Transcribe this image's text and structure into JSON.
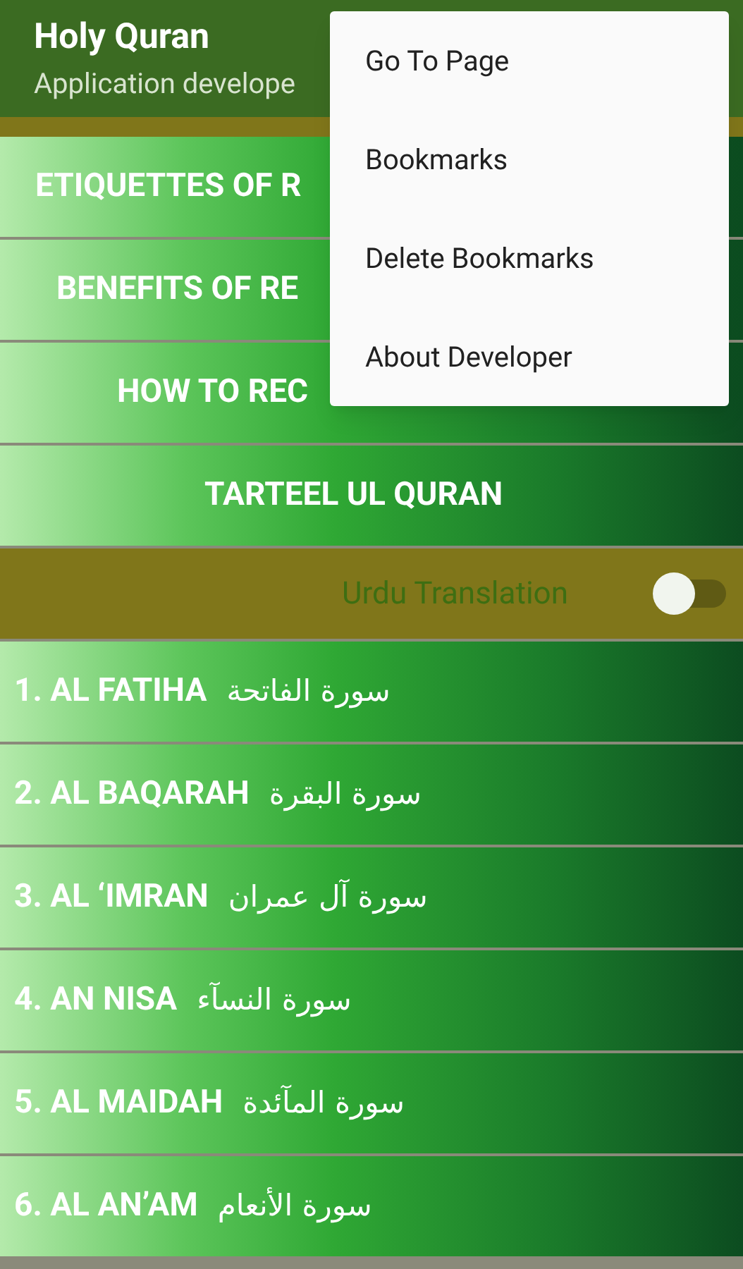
{
  "app_bar": {
    "title": "Holy Quran",
    "subtitle": "Application develope"
  },
  "topics": [
    {
      "label": "ETIQUETTES OF R"
    },
    {
      "label": "BENEFITS OF RE"
    },
    {
      "label": "HOW TO REC"
    },
    {
      "label": "TARTEEL UL QURAN"
    }
  ],
  "translation_toggle": {
    "label": "Urdu Translation",
    "on": false
  },
  "surahs": [
    {
      "name": "1. AL FATIHA",
      "arabic": "سورة الفاتحة"
    },
    {
      "name": "2. AL BAQARAH",
      "arabic": "سورة البقرة"
    },
    {
      "name": "3. AL ‘IMRAN",
      "arabic": "سورة آل عمران"
    },
    {
      "name": "4. AN NISA",
      "arabic": "سورة النسآء"
    },
    {
      "name": "5. AL MAIDAH",
      "arabic": "سورة المآئدة"
    },
    {
      "name": "6. AL AN’AM",
      "arabic": "سورة الأنعام"
    }
  ],
  "menu": {
    "items": [
      "Go To Page",
      "Bookmarks",
      "Delete Bookmarks",
      "About Developer"
    ]
  }
}
